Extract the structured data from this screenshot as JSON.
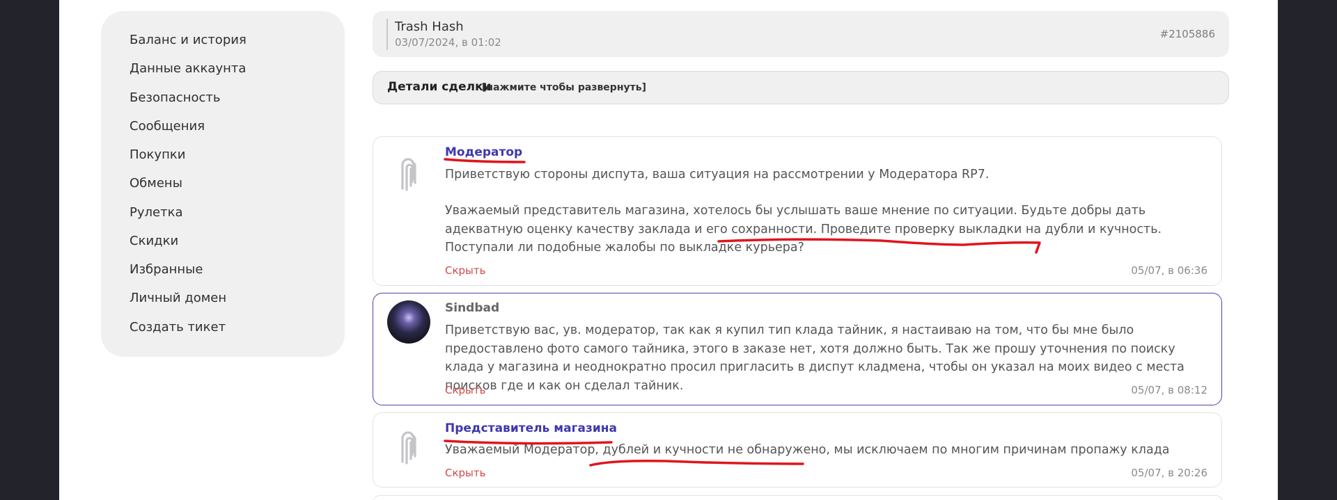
{
  "sidebar": {
    "items": [
      {
        "label": "Баланс и история"
      },
      {
        "label": "Данные аккаунта"
      },
      {
        "label": "Безопасность"
      },
      {
        "label": "Сообщения"
      },
      {
        "label": "Покупки"
      },
      {
        "label": "Обмены"
      },
      {
        "label": "Рулетка"
      },
      {
        "label": "Скидки"
      },
      {
        "label": "Избранные"
      },
      {
        "label": "Личный домен"
      },
      {
        "label": "Создать тикет"
      }
    ]
  },
  "deal": {
    "title": "Trash Hash",
    "date": "03/07/2024, в 01:02",
    "id": "#2105886"
  },
  "details": {
    "title": "Детали сделки",
    "hint": "[нажмите чтобы развернуть]"
  },
  "messages": [
    {
      "author": "Модератор",
      "avatar": "logo-icon",
      "text_p1": "Приветствую стороны диспута, ваша ситуация на рассмотрении у Модератора RP7.",
      "text_p2": "Уважаемый представитель магазина, хотелось бы услышать ваше мнение по ситуации. Будьте добры дать адекватную оценку качеству заклада и его сохранности. Проведите проверку выкладки на дубли и кучность. Поступали ли подобные жалобы по выкладке курьера?",
      "hide_label": "Скрыть",
      "time": "05/07, в 06:36"
    },
    {
      "author": "Sindbad",
      "avatar": "user-avatar",
      "text": "Приветствую вас, ув. модератор, так как я купил тип клада тайник, я настаиваю на том, что бы мне было предоставлено фото самого тайника, этого в заказе нет, хотя должно быть. Так же прошу уточнения по поиску клада у магазина и неоднократно просил пригласить в диспут кладмена, чтобы он указал на моих видео с места поисков где и как он сделал тайник.",
      "hide_label": "Скрыть",
      "time": "05/07, в 08:12"
    },
    {
      "author": "Представитель магазина",
      "avatar": "logo-icon",
      "text": "Уважаемый Модератор, дублей и кучности не обнаружено, мы исключаем по многим причинам пропажу клада",
      "hide_label": "Скрыть",
      "time": "05/07, в 20:26"
    }
  ],
  "colors": {
    "accent": "#3e37b0",
    "hide_link": "#d04a4a",
    "annotation": "#e0151d",
    "panel": "#f0f0f0",
    "frame": "#23232b"
  }
}
